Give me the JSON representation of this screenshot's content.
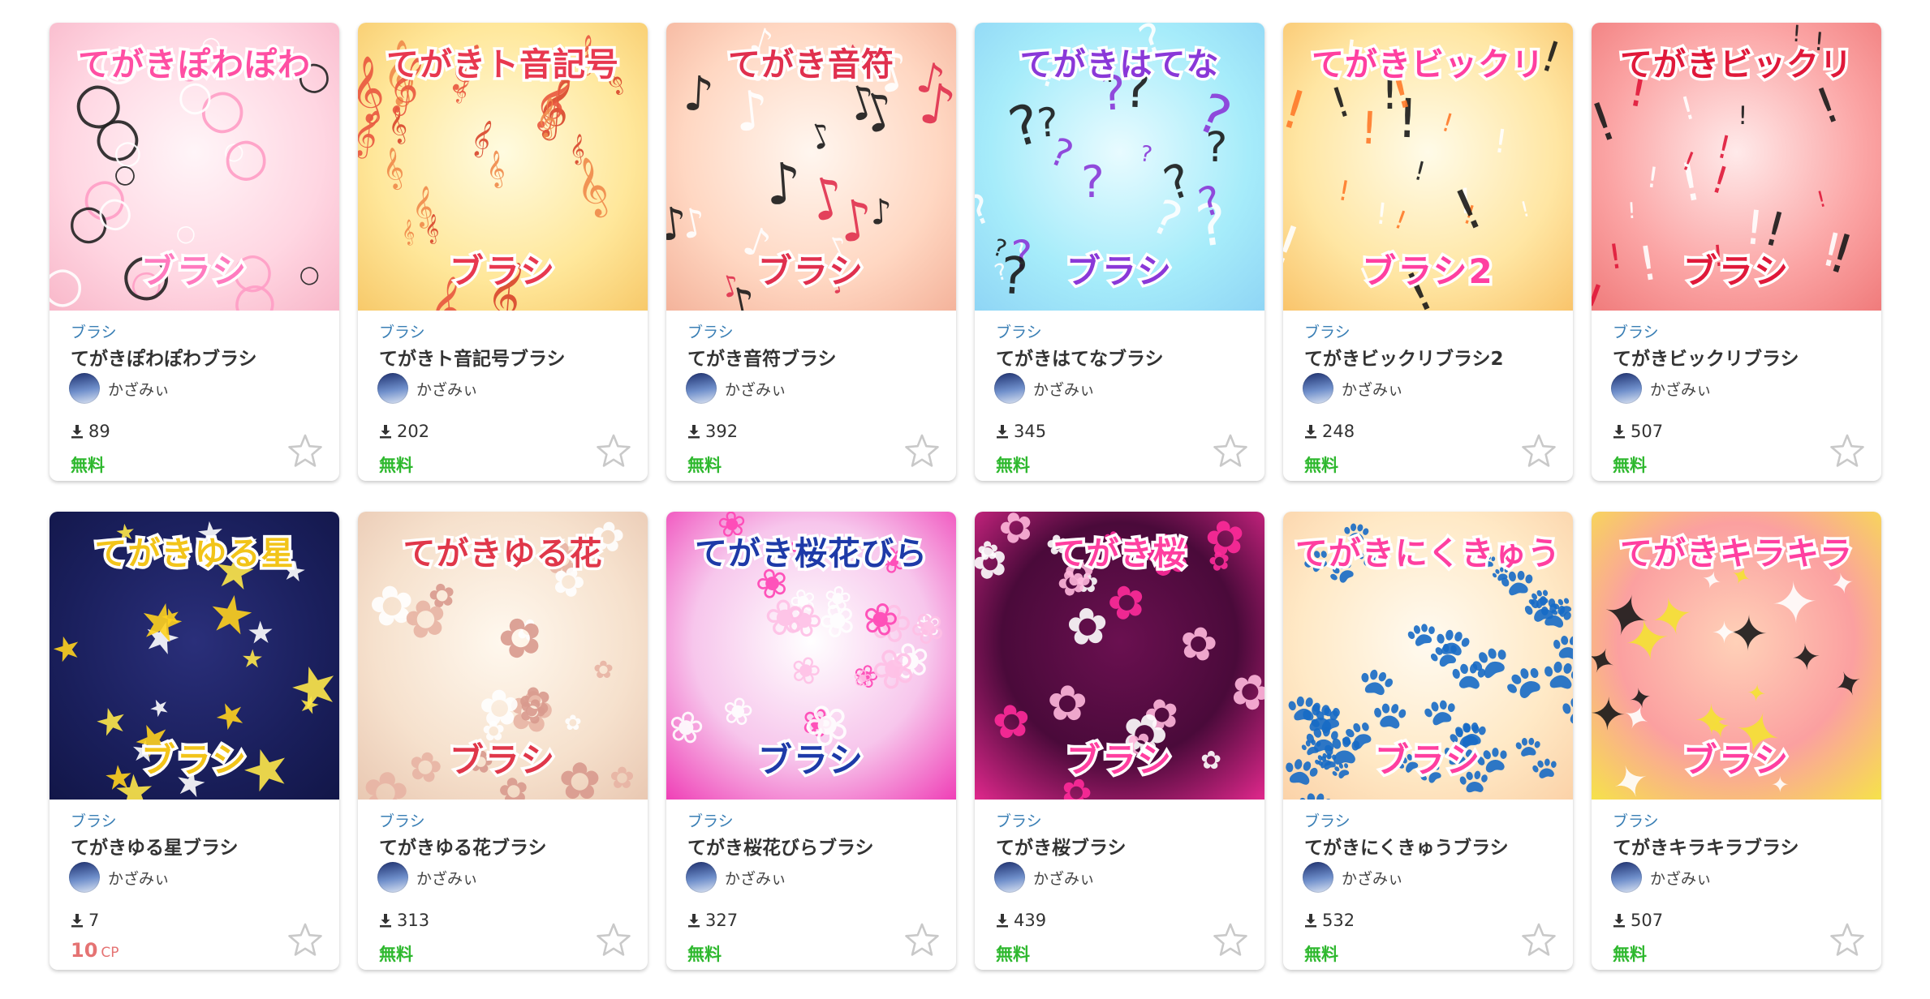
{
  "cards": [
    {
      "category": "ブラシ",
      "name": "てがきぽわぽわブラシ",
      "author": "かざみぃ",
      "downloads": "89",
      "price": "無料",
      "paid": false,
      "thumb": {
        "title": "てがきぽわぽわ",
        "subtitle": "ブラシ",
        "bg": "radial-gradient(circle at 50% 45%, #fff5f8 0%, #ffd6e2 60%, #f8b7c9 100%)",
        "title_color": "#ff4fa3",
        "sub_color": "#ff7bbf",
        "decor": "○",
        "decor_colors": [
          "#ffffff",
          "#ff9ec6",
          "#222222"
        ]
      }
    },
    {
      "category": "ブラシ",
      "name": "てがきト音記号ブラシ",
      "author": "かざみぃ",
      "downloads": "202",
      "price": "無料",
      "paid": false,
      "thumb": {
        "title": "てがきト音記号",
        "subtitle": "ブラシ",
        "bg": "radial-gradient(circle at 50% 45%, #fffbe0 0%, #ffe79a 60%, #f7c96a 100%)",
        "title_color": "#e8384f",
        "sub_color": "#e8384f",
        "decor": "𝄞",
        "decor_colors": [
          "#e9573f",
          "#f08a4b",
          "#d9452c"
        ]
      }
    },
    {
      "category": "ブラシ",
      "name": "てがき音符ブラシ",
      "author": "かざみぃ",
      "downloads": "392",
      "price": "無料",
      "paid": false,
      "thumb": {
        "title": "てがき音符",
        "subtitle": "ブラシ",
        "bg": "radial-gradient(circle at 50% 45%, #fff6ef 0%, #ffd7c2 60%, #f4b39b 100%)",
        "title_color": "#e0304e",
        "sub_color": "#e0304e",
        "decor": "♪",
        "decor_colors": [
          "#1a1a1a",
          "#e0304e",
          "#ffffff"
        ]
      }
    },
    {
      "category": "ブラシ",
      "name": "てがきはてなブラシ",
      "author": "かざみぃ",
      "downloads": "345",
      "price": "無料",
      "paid": false,
      "thumb": {
        "title": "てがきはてな",
        "subtitle": "ブラシ",
        "bg": "radial-gradient(circle at 50% 45%, #e8fbff 0%, #a6ecfa 60%, #8fd5f5 100%)",
        "title_color": "#8a38d8",
        "sub_color": "#8a38d8",
        "decor": "?",
        "decor_colors": [
          "#1a1a1a",
          "#ffffff",
          "#8a38d8"
        ]
      }
    },
    {
      "category": "ブラシ",
      "name": "てがきビックリブラシ2",
      "author": "かざみぃ",
      "downloads": "248",
      "price": "無料",
      "paid": false,
      "thumb": {
        "title": "てがきビックリ",
        "subtitle": "ブラシ2",
        "bg": "radial-gradient(circle at 50% 45%, #fffbe8 0%, #ffe6a3 60%, #f9c46b 100%)",
        "title_color": "#ff3fa0",
        "sub_color": "#ff3fa0",
        "decor": "!",
        "decor_colors": [
          "#ffffff",
          "#ff7a2a",
          "#1a1a1a"
        ]
      }
    },
    {
      "category": "ブラシ",
      "name": "てがきビックリブラシ",
      "author": "かざみぃ",
      "downloads": "507",
      "price": "無料",
      "paid": false,
      "thumb": {
        "title": "てがきビックリ",
        "subtitle": "ブラシ",
        "bg": "radial-gradient(circle at 50% 45%, #ffeaea 0%, #fba4a4 60%, #f07b7b 100%)",
        "title_color": "#e0193a",
        "sub_color": "#e0193a",
        "decor": "!",
        "decor_colors": [
          "#e0193a",
          "#ffffff",
          "#1a1a1a"
        ]
      }
    },
    {
      "category": "ブラシ",
      "name": "てがきゆる星ブラシ",
      "author": "かざみぃ",
      "downloads": "7",
      "price": "10",
      "price_unit": "CP",
      "paid": true,
      "thumb": {
        "title": "てがきゆる星",
        "subtitle": "ブラシ",
        "bg": "radial-gradient(circle at 50% 45%, #2a2f7a 0%, #1a1f5c 60%, #121648 100%)",
        "title_color": "#f2c419",
        "sub_color": "#f2c419",
        "decor": "★",
        "decor_colors": [
          "#ffe84a",
          "#ffffff",
          "#ffd21f"
        ]
      }
    },
    {
      "category": "ブラシ",
      "name": "てがきゆる花ブラシ",
      "author": "かざみぃ",
      "downloads": "313",
      "price": "無料",
      "paid": false,
      "thumb": {
        "title": "てがきゆる花",
        "subtitle": "ブラシ",
        "bg": "radial-gradient(circle at 50% 45%, #fff8ee 0%, #f6e1cd 60%, #e9c8b2 100%)",
        "title_color": "#e0374a",
        "sub_color": "#e0374a",
        "decor": "✿",
        "decor_colors": [
          "#ffffff",
          "#d99a8e",
          "#e8b4a4"
        ]
      }
    },
    {
      "category": "ブラシ",
      "name": "てがき桜花びらブラシ",
      "author": "かざみぃ",
      "downloads": "327",
      "price": "無料",
      "paid": false,
      "thumb": {
        "title": "てがき桜花びら",
        "subtitle": "ブラシ",
        "bg": "radial-gradient(circle at 50% 45%, #ffffff 0%, #f7c6ec 55%, #ef3fb6 100%)",
        "title_color": "#1e3aa8",
        "sub_color": "#1e3aa8",
        "decor": "❀",
        "decor_colors": [
          "#ffffff",
          "#ff44b4",
          "#ffc0e6"
        ]
      }
    },
    {
      "category": "ブラシ",
      "name": "てがき桜ブラシ",
      "author": "かざみぃ",
      "downloads": "439",
      "price": "無料",
      "paid": false,
      "thumb": {
        "title": "てがき桜",
        "subtitle": "ブラシ",
        "bg": "radial-gradient(circle at 50% 45%, #6a1050 0%, #4a0a3a 55%, #e0288c 100%)",
        "title_color": "#ff3fa0",
        "sub_color": "#ff3fa0",
        "decor": "✿",
        "decor_colors": [
          "#ffb7dc",
          "#ff2b9a",
          "#ffffff"
        ]
      }
    },
    {
      "category": "ブラシ",
      "name": "てがきにくきゅうブラシ",
      "author": "かざみぃ",
      "downloads": "532",
      "price": "無料",
      "paid": false,
      "thumb": {
        "title": "てがきにくきゅう",
        "subtitle": "ブラシ",
        "bg": "radial-gradient(circle at 50% 45%, #fffaf0 0%, #ffe9c6 60%, #fbd2a8 100%)",
        "title_color": "#ff3fa0",
        "sub_color": "#ff3fa0",
        "decor": "🐾",
        "decor_colors": [
          "#ff8fb8",
          "#ffffff",
          "#1a1a1a"
        ]
      }
    },
    {
      "category": "ブラシ",
      "name": "てがきキラキラブラシ",
      "author": "かざみぃ",
      "downloads": "507",
      "price": "無料",
      "paid": false,
      "thumb": {
        "title": "てがきキラキラ",
        "subtitle": "ブラシ",
        "bg": "radial-gradient(circle at 50% 45%, #ffd1b8 0%, #fba0a0 55%, #f6e24a 100%)",
        "title_color": "#ff3fa0",
        "sub_color": "#ff3fa0",
        "decor": "✦",
        "decor_colors": [
          "#ffffff",
          "#f5e233",
          "#1a1a1a"
        ]
      }
    }
  ],
  "icons": {
    "download": "download-icon",
    "favorite": "star-outline-icon",
    "avatar": "avatar-image"
  },
  "colors": {
    "category": "#3a7fb5",
    "free": "#2eb82e",
    "paid": "#e57373",
    "star": "#c9c9c9"
  }
}
